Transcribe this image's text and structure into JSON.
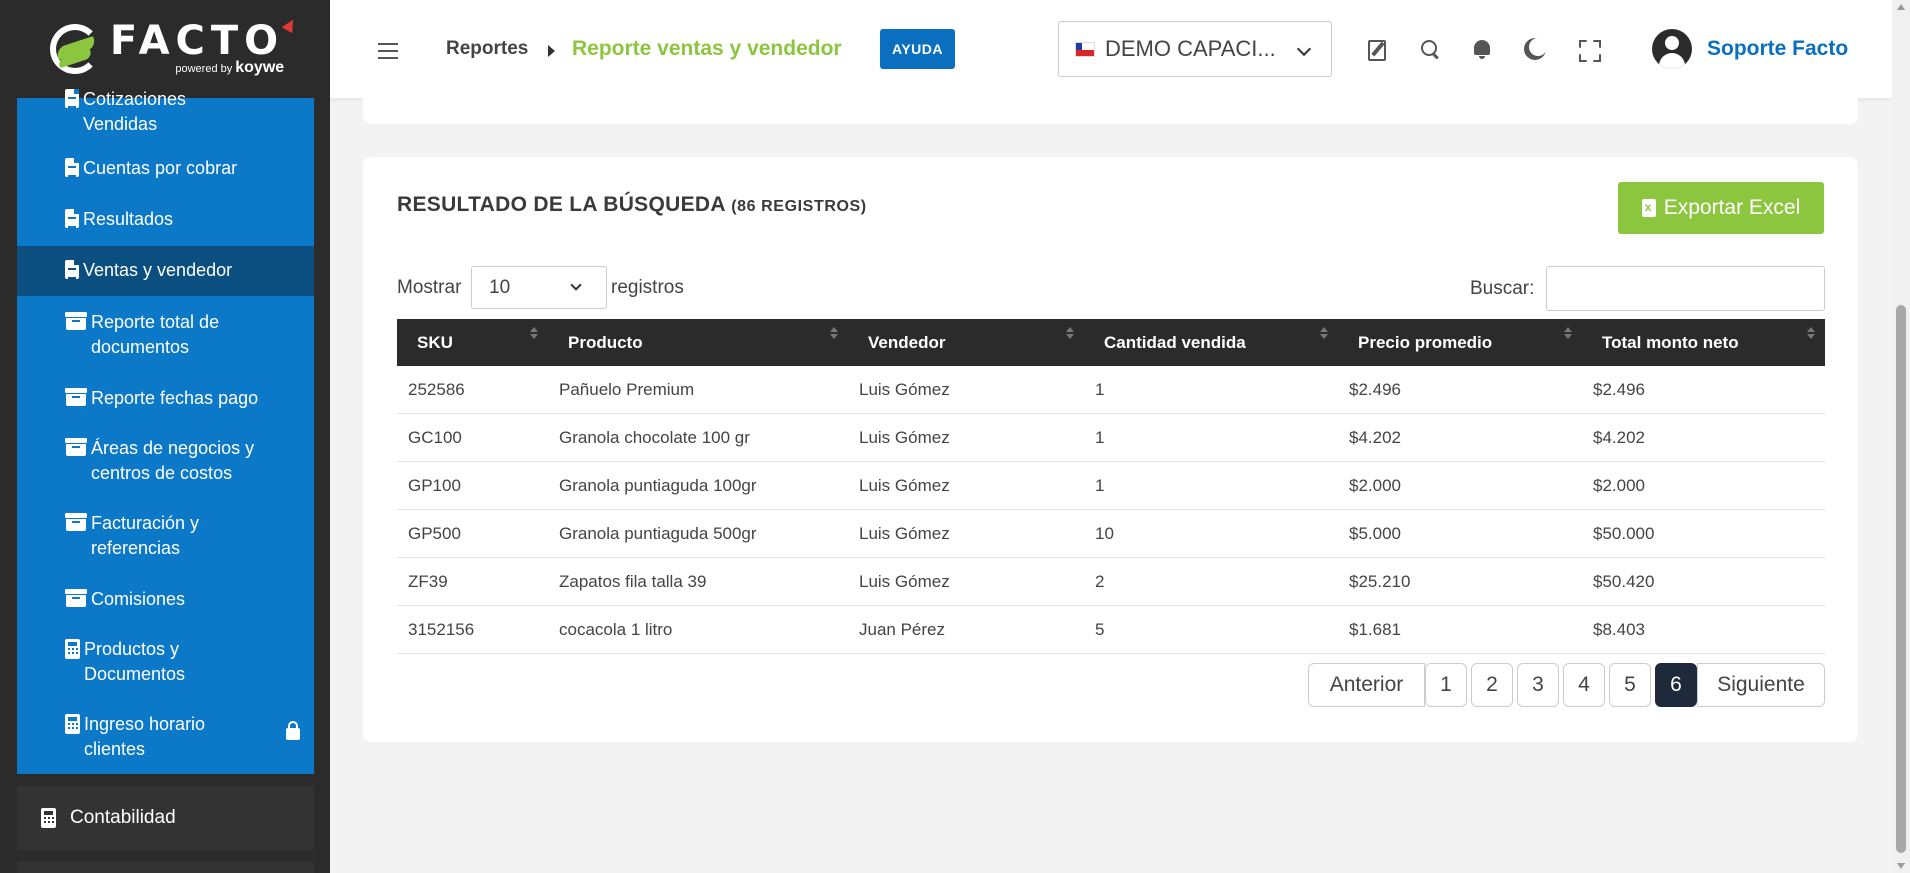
{
  "brand": {
    "name": "FACTO",
    "powered_by": "powered by",
    "powered_brand": "koywe",
    "accent_green": "#8cc63f",
    "accent_blue": "#0c78c8"
  },
  "sidebar": {
    "items": [
      {
        "label": "Cotizaciones Vendidas",
        "icon": "document-icon",
        "active": false
      },
      {
        "label": "Cuentas por cobrar",
        "icon": "document-icon",
        "active": false
      },
      {
        "label": "Resultados",
        "icon": "document-icon",
        "active": false
      },
      {
        "label": "Ventas y vendedor",
        "icon": "document-icon",
        "active": true
      },
      {
        "label": "Reporte total de documentos",
        "icon": "archive-icon",
        "active": false
      },
      {
        "label": "Reporte fechas pago",
        "icon": "archive-icon",
        "active": false
      },
      {
        "label": "Áreas de negocios y centros de costos",
        "icon": "archive-icon",
        "active": false
      },
      {
        "label": "Facturación y referencias",
        "icon": "archive-icon",
        "active": false
      },
      {
        "label": "Comisiones",
        "icon": "archive-icon",
        "active": false
      },
      {
        "label": "Productos y Documentos",
        "icon": "calculator-icon",
        "active": false
      },
      {
        "label": "Ingreso horario clientes",
        "icon": "calculator-icon",
        "active": false,
        "locked": true
      }
    ],
    "section": {
      "label": "Contabilidad",
      "icon": "calculator-icon"
    }
  },
  "header": {
    "breadcrumb_root": "Reportes",
    "breadcrumb_current": "Reporte ventas y vendedor",
    "help_label": "AYUDA",
    "company": "DEMO CAPACI...",
    "company_flag": "chile-flag-icon",
    "user_name": "Soporte Facto"
  },
  "results": {
    "title": "RESULTADO DE LA BÚSQUEDA",
    "count_text": "(86 REGISTROS)",
    "export_label": "Exportar Excel",
    "show_label": "Mostrar",
    "page_size": "10",
    "records_label": "registros",
    "search_label": "Buscar:",
    "search_value": ""
  },
  "table": {
    "headers": [
      "SKU",
      "Producto",
      "Vendedor",
      "Cantidad vendida",
      "Precio promedio",
      "Total monto neto"
    ],
    "rows": [
      [
        "252586",
        "Pañuelo Premium",
        "Luis Gómez",
        "1",
        "$2.496",
        "$2.496"
      ],
      [
        "GC100",
        "Granola chocolate 100 gr",
        "Luis Gómez",
        "1",
        "$4.202",
        "$4.202"
      ],
      [
        "GP100",
        "Granola puntiaguda 100gr",
        "Luis Gómez",
        "1",
        "$2.000",
        "$2.000"
      ],
      [
        "GP500",
        "Granola puntiaguda 500gr",
        "Luis Gómez",
        "10",
        "$5.000",
        "$50.000"
      ],
      [
        "ZF39",
        "Zapatos fila talla 39",
        "Luis Gómez",
        "2",
        "$25.210",
        "$50.420"
      ],
      [
        "3152156",
        "cocacola 1 litro",
        "Juan Pérez",
        "5",
        "$1.681",
        "$8.403"
      ]
    ]
  },
  "pagination": {
    "prev_label": "Anterior",
    "pages": [
      "1",
      "2",
      "3",
      "4",
      "5",
      "6"
    ],
    "current_page": "6",
    "next_label": "Siguiente"
  }
}
